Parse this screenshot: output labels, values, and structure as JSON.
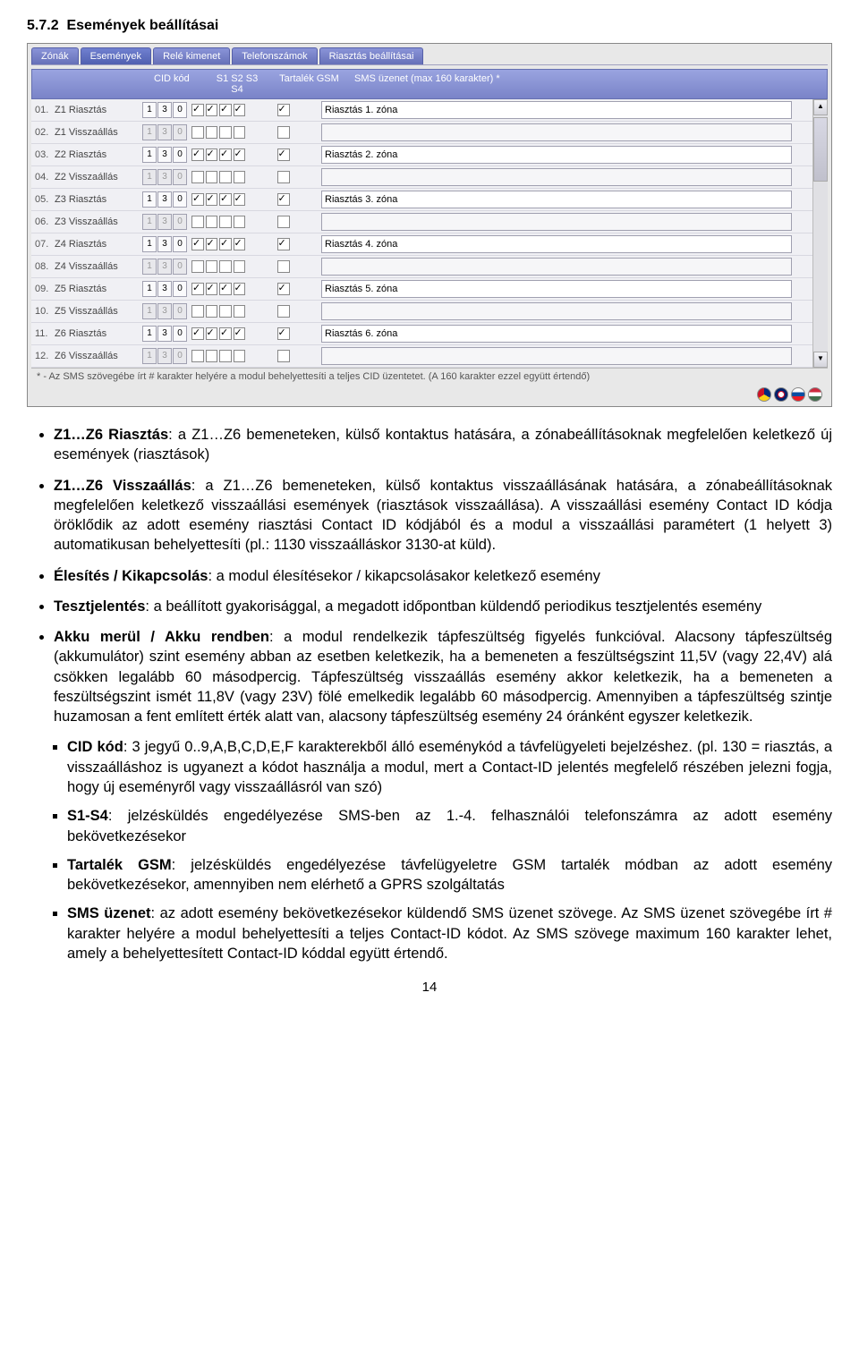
{
  "section_number": "5.7.2",
  "section_title": "Események beállításai",
  "tabs": [
    "Zónák",
    "Események",
    "Relé kimenet",
    "Telefonszámok",
    "Riasztás beállításai"
  ],
  "active_tab": 1,
  "headers": {
    "cid": "CID kód",
    "s": "S1 S2 S3 S4",
    "gsm": "Tartalék GSM",
    "sms": "SMS üzenet (max 160 karakter) *"
  },
  "rows": [
    {
      "idx": "01.",
      "name": "Z1 Riasztás",
      "cid": [
        "1",
        "3",
        "0"
      ],
      "checks": [
        true,
        true,
        true,
        true
      ],
      "gsm": true,
      "sms": "Riasztás 1. zóna"
    },
    {
      "idx": "02.",
      "name": "Z1 Visszaállás",
      "cid": [
        "1",
        "3",
        "0"
      ],
      "checks": [
        false,
        false,
        false,
        false
      ],
      "gsm": false,
      "sms": ""
    },
    {
      "idx": "03.",
      "name": "Z2 Riasztás",
      "cid": [
        "1",
        "3",
        "0"
      ],
      "checks": [
        true,
        true,
        true,
        true
      ],
      "gsm": true,
      "sms": "Riasztás 2. zóna"
    },
    {
      "idx": "04.",
      "name": "Z2 Visszaállás",
      "cid": [
        "1",
        "3",
        "0"
      ],
      "checks": [
        false,
        false,
        false,
        false
      ],
      "gsm": false,
      "sms": ""
    },
    {
      "idx": "05.",
      "name": "Z3 Riasztás",
      "cid": [
        "1",
        "3",
        "0"
      ],
      "checks": [
        true,
        true,
        true,
        true
      ],
      "gsm": true,
      "sms": "Riasztás 3. zóna"
    },
    {
      "idx": "06.",
      "name": "Z3 Visszaállás",
      "cid": [
        "1",
        "3",
        "0"
      ],
      "checks": [
        false,
        false,
        false,
        false
      ],
      "gsm": false,
      "sms": ""
    },
    {
      "idx": "07.",
      "name": "Z4 Riasztás",
      "cid": [
        "1",
        "3",
        "0"
      ],
      "checks": [
        true,
        true,
        true,
        true
      ],
      "gsm": true,
      "sms": "Riasztás 4. zóna"
    },
    {
      "idx": "08.",
      "name": "Z4 Visszaállás",
      "cid": [
        "1",
        "3",
        "0"
      ],
      "checks": [
        false,
        false,
        false,
        false
      ],
      "gsm": false,
      "sms": ""
    },
    {
      "idx": "09.",
      "name": "Z5 Riasztás",
      "cid": [
        "1",
        "3",
        "0"
      ],
      "checks": [
        true,
        true,
        true,
        true
      ],
      "gsm": true,
      "sms": "Riasztás 5. zóna"
    },
    {
      "idx": "10.",
      "name": "Z5 Visszaállás",
      "cid": [
        "1",
        "3",
        "0"
      ],
      "checks": [
        false,
        false,
        false,
        false
      ],
      "gsm": false,
      "sms": ""
    },
    {
      "idx": "11.",
      "name": "Z6 Riasztás",
      "cid": [
        "1",
        "3",
        "0"
      ],
      "checks": [
        true,
        true,
        true,
        true
      ],
      "gsm": true,
      "sms": "Riasztás 6. zóna"
    },
    {
      "idx": "12.",
      "name": "Z6 Visszaállás",
      "cid": [
        "1",
        "3",
        "0"
      ],
      "checks": [
        false,
        false,
        false,
        false
      ],
      "gsm": false,
      "sms": ""
    }
  ],
  "footer_note": "* - Az SMS szövegébe írt # karakter helyére a modul behelyettesíti a teljes CID üzentetet. (A 160 karakter ezzel együtt értendő)",
  "bullets": {
    "b1_label": "Z1…Z6 Riasztás",
    "b1_text": ": a Z1…Z6 bemeneteken, külső kontaktus hatására, a zónabeállításoknak megfelelően keletkező új események (riasztások)",
    "b2_label": "Z1…Z6 Visszaállás",
    "b2_text": ": a Z1…Z6 bemeneteken, külső kontaktus visszaállásának hatására, a zónabeállításoknak megfelelően keletkező visszaállási események (riasztások visszaállása). A visszaállási esemény Contact ID kódja öröklődik az adott esemény riasztási Contact ID kódjából és a modul a visszaállási paramétert (1 helyett 3) automatikusan behelyettesíti (pl.: 1130 visszaálláskor 3130-at küld).",
    "b3_label": "Élesítés / Kikapcsolás",
    "b3_text": ": a modul élesítésekor / kikapcsolásakor keletkező esemény",
    "b4_label": "Tesztjelentés",
    "b4_text": ": a beállított gyakorisággal, a megadott időpontban küldendő periodikus tesztjelentés esemény",
    "b5_label": "Akku merül / Akku rendben",
    "b5_text": ": a modul rendelkezik tápfeszültség figyelés funkcióval. Alacsony tápfeszültség (akkumulátor) szint esemény abban az esetben keletkezik, ha a bemeneten a feszültségszint 11,5V (vagy 22,4V) alá csökken legalább 60 másodpercig. Tápfeszültség visszaállás esemény akkor keletkezik, ha a bemeneten a feszültségszint ismét 11,8V (vagy 23V) fölé emelkedik legalább 60 másodpercig. Amennyiben a tápfeszültség szintje huzamosan a fent említett érték alatt van, alacsony tápfeszültség esemény 24 óránként egyszer keletkezik.",
    "s1_label": "CID kód",
    "s1_text": ": 3 jegyű 0..9,A,B,C,D,E,F karakterekből álló eseménykód a távfelügyeleti bejelzéshez. (pl. 130 = riasztás, a visszaálláshoz is ugyanezt a kódot használja a modul, mert a Contact-ID jelentés megfelelő részében jelezni fogja, hogy új eseményről vagy visszaállásról van szó)",
    "s2_label": "S1-S4",
    "s2_text": ": jelzésküldés engedélyezése SMS-ben az 1.-4. felhasználói telefonszámra az adott esemény bekövetkezésekor",
    "s3_label": "Tartalék GSM",
    "s3_text": ": jelzésküldés engedélyezése távfelügyeletre GSM tartalék módban az adott esemény bekövetkezésekor, amennyiben nem elérhető a GPRS szolgáltatás",
    "s4_label": "SMS üzenet",
    "s4_text": ": az adott esemény bekövetkezésekor küldendő SMS üzenet szövege. Az SMS üzenet szövegébe írt # karakter helyére a modul behelyettesíti a teljes Contact-ID kódot. Az SMS szövege maximum 160 karakter lehet, amely a behelyettesített Contact-ID kóddal együtt értendő."
  },
  "page_number": "14"
}
